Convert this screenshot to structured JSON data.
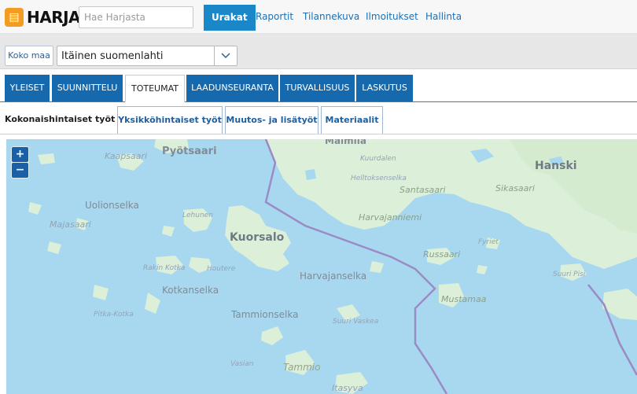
{
  "app": {
    "logo_text": "HARJA",
    "search_placeholder": "Hae Harjasta"
  },
  "nav": {
    "items": [
      {
        "label": "Urakat",
        "active": true
      },
      {
        "label": "Raportit"
      },
      {
        "label": "Tilannekuva"
      },
      {
        "label": "Ilmoitukset"
      },
      {
        "label": "Hallinta"
      }
    ]
  },
  "selector": {
    "koko_maa_label": "Koko maa",
    "contract_value": "Itäinen suomenlahti"
  },
  "main_tabs": [
    {
      "label": "YLEISET"
    },
    {
      "label": "SUUNNITTELU"
    },
    {
      "label": "TOTEUMAT",
      "active": true
    },
    {
      "label": "LAADUNSEURANTA"
    },
    {
      "label": "TURVALLISUUS"
    },
    {
      "label": "LASKUTUS"
    }
  ],
  "sub_tabs": [
    {
      "label": "Kokonaishintaiset työt",
      "active": true
    },
    {
      "label": "Yksikköhintaiset työt"
    },
    {
      "label": "Muutos- ja lisätyöt"
    },
    {
      "label": "Materiaalit"
    }
  ],
  "map": {
    "zoom_in": "+",
    "zoom_out": "−",
    "labels": [
      "Pyötsaari",
      "Kaapsaari",
      "Malmila",
      "Kuurdalen",
      "Hanski",
      "Helltoksenselka",
      "Santasaari",
      "Sikasaari",
      "Uolionselka",
      "Lehunen",
      "Majasaari",
      "Harvajanniemi",
      "Kuorsalo",
      "Fyriet",
      "Russaari",
      "Rakin Kotka",
      "Houtere",
      "Harvajanselka",
      "Suuri Pisi",
      "Kotkanselka",
      "Mustamaa",
      "Pitka-Kotka",
      "Tammionselka",
      "Suuri Vaskea",
      "Vasian",
      "Tammio",
      "Itasyva"
    ]
  },
  "colors": {
    "accent": "#1a87c9",
    "tab_bg": "#1669ad",
    "water": "#a8d8f0",
    "land": "#dcefd8",
    "border_line": "#9b8bc4",
    "logo": "#f39c1f"
  }
}
